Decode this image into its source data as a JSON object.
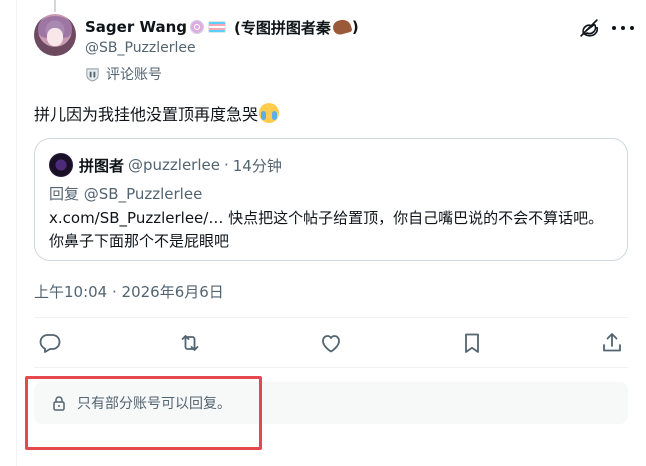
{
  "post": {
    "author": {
      "display_name": "Sager Wang",
      "name_suffix": "(专图拼图者秦",
      "name_close": ")",
      "handle": "@SB_Puzzlerlee",
      "label": "评论账号"
    },
    "text": "拼儿因为我挂他没置顶再度急哭",
    "timestamp": "上午10:04 · 2026年6月6日"
  },
  "quote": {
    "author_name": "拼图者",
    "handle": "@puzzlerlee",
    "separator": "·",
    "time": "14分钟",
    "reply_to": "回复 @SB_Puzzlerlee",
    "body": "x.com/SB_Puzzlerlee/… 快点把这个帖子给置顶，你自己嘴巴说的不会不算话吧。你鼻子下面那个不是屁眼吧"
  },
  "restriction": {
    "text": "只有部分账号可以回复。"
  },
  "colors": {
    "text_primary": "#0f1419",
    "text_secondary": "#536471",
    "border": "#cfd9de",
    "divider": "#eff3f4",
    "restriction_bg": "#f7f9f9",
    "highlight": "#e5484d"
  },
  "icons": [
    "grok-icon",
    "more-icon",
    "label-shield-icon",
    "reply-icon",
    "repost-icon",
    "like-icon",
    "bookmark-icon",
    "share-icon",
    "lock-icon"
  ]
}
